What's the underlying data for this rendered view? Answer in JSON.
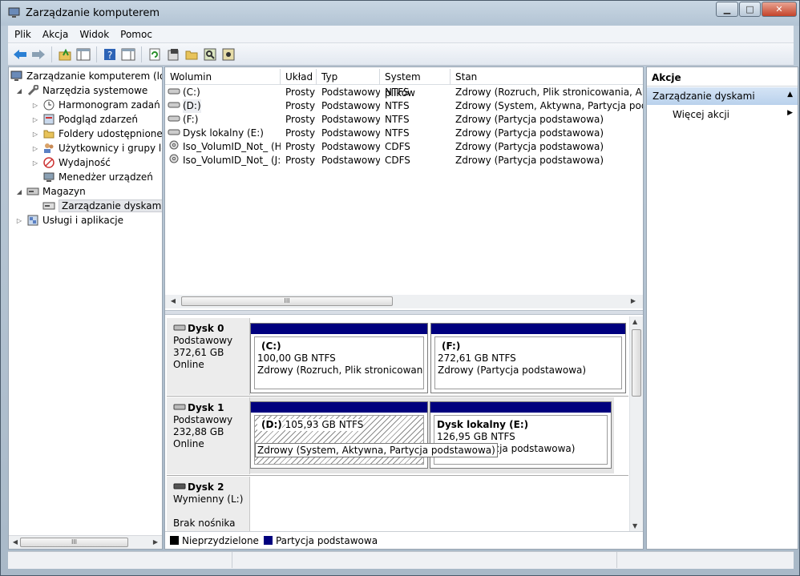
{
  "window": {
    "title": "Zarządzanie komputerem"
  },
  "menu": [
    "Plik",
    "Akcja",
    "Widok",
    "Pomoc"
  ],
  "toolbar": [
    "back-icon",
    "forward-icon",
    "up-folder-icon",
    "show-hide-tree-icon",
    "help-icon",
    "show-hide-action-icon",
    "refresh-icon",
    "properties-icon",
    "open-icon",
    "search-icon",
    "settings-icon"
  ],
  "tree": [
    {
      "label": "Zarządzanie komputerem (loka",
      "level": 0,
      "exp": "",
      "icon": "computer-management-icon"
    },
    {
      "label": "Narzędzia systemowe",
      "level": 1,
      "exp": "◢",
      "icon": "tools-icon"
    },
    {
      "label": "Harmonogram zadań",
      "level": 2,
      "exp": "▷",
      "icon": "clock-icon"
    },
    {
      "label": "Podgląd zdarzeń",
      "level": 2,
      "exp": "▷",
      "icon": "event-viewer-icon"
    },
    {
      "label": "Foldery udostępnione",
      "level": 2,
      "exp": "▷",
      "icon": "shared-folder-icon"
    },
    {
      "label": "Użytkownicy i grupy lok",
      "level": 2,
      "exp": "▷",
      "icon": "users-icon"
    },
    {
      "label": "Wydajność",
      "level": 2,
      "exp": "▷",
      "icon": "performance-icon"
    },
    {
      "label": "Menedżer urządzeń",
      "level": 2,
      "exp": "",
      "icon": "device-manager-icon"
    },
    {
      "label": "Magazyn",
      "level": 1,
      "exp": "◢",
      "icon": "storage-icon"
    },
    {
      "label": "Zarządzanie dyskami",
      "level": 2,
      "exp": "",
      "icon": "disk-management-icon",
      "selected": true
    },
    {
      "label": "Usługi i aplikacje",
      "level": 1,
      "exp": "▷",
      "icon": "services-icon"
    }
  ],
  "volumes": {
    "columns": [
      "Wolumin",
      "Układ",
      "Typ",
      "System plików",
      "Stan"
    ],
    "rows": [
      {
        "name": "(C:)",
        "layout": "Prosty",
        "type": "Podstawowy",
        "fs": "NTFS",
        "status": "Zdrowy (Rozruch, Plik stronicowania, Aktywn"
      },
      {
        "name": "(D:)",
        "layout": "Prosty",
        "type": "Podstawowy",
        "fs": "NTFS",
        "status": "Zdrowy (System, Aktywna, Partycja podstaw"
      },
      {
        "name": "(F:)",
        "layout": "Prosty",
        "type": "Podstawowy",
        "fs": "NTFS",
        "status": "Zdrowy (Partycja podstawowa)"
      },
      {
        "name": "Dysk lokalny (E:)",
        "layout": "Prosty",
        "type": "Podstawowy",
        "fs": "NTFS",
        "status": "Zdrowy (Partycja podstawowa)"
      },
      {
        "name": "Iso_VolumID_Not_ (H:)",
        "layout": "Prosty",
        "type": "Podstawowy",
        "fs": "CDFS",
        "status": "Zdrowy (Partycja podstawowa)"
      },
      {
        "name": "Iso_VolumID_Not_ (J:)",
        "layout": "Prosty",
        "type": "Podstawowy",
        "fs": "CDFS",
        "status": "Zdrowy (Partycja podstawowa)"
      }
    ]
  },
  "disks": [
    {
      "name": "Dysk 0",
      "type": "Podstawowy",
      "size": "372,61 GB",
      "state": "Online",
      "partitions": [
        {
          "label": "(C:)",
          "size": "100,00 GB NTFS",
          "status": "Zdrowy (Rozruch, Plik stronicowania, Ak"
        },
        {
          "label": "(F:)",
          "size": "272,61 GB NTFS",
          "status": "Zdrowy (Partycja podstawowa)"
        }
      ]
    },
    {
      "name": "Dysk 1",
      "type": "Podstawowy",
      "size": "232,88 GB",
      "state": "Online",
      "partitions": [
        {
          "label": "(D:)",
          "size": "105,93 GB NTFS",
          "status": "Zdrowy (System, Aktywna, Partycja podstawowa)"
        },
        {
          "label": "Dysk lokalny  (E:)",
          "size": "126,95 GB NTFS",
          "status": "Zdrowy (Partycja podstawowa)",
          "visible_status": "(Partycja podstawowa)"
        }
      ]
    },
    {
      "name": "Dysk 2",
      "type": "Wymienny (L:)",
      "extra": "Brak nośnika"
    }
  ],
  "tooltip": "Zdrowy (System, Aktywna, Partycja podstawowa)",
  "legend": [
    {
      "label": "Nieprzydzielone",
      "color": "#000000"
    },
    {
      "label": "Partycja podstawowa",
      "color": "#00007e"
    }
  ],
  "actions": {
    "title": "Akcje",
    "section": "Zarządzanie dyskami",
    "more": "Więcej akcji"
  },
  "scroll_glyph": "III"
}
